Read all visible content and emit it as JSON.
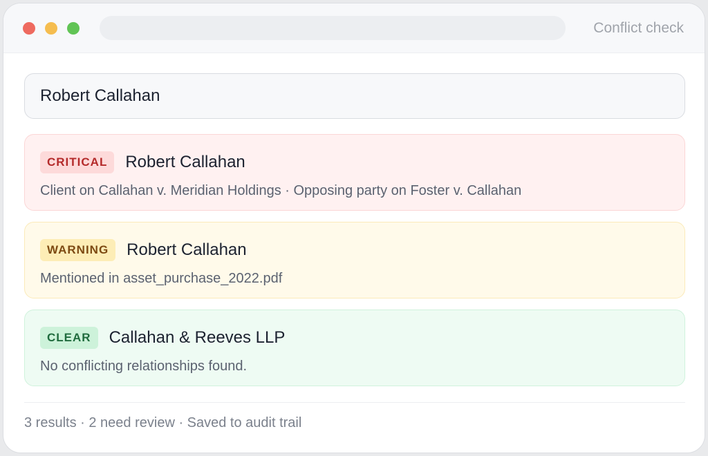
{
  "window": {
    "title": "Conflict check"
  },
  "search": {
    "value": "Robert Callahan"
  },
  "results": [
    {
      "level": "CRITICAL",
      "name": "Robert Callahan",
      "detail": "Client on Callahan v. Meridian Holdings · Opposing party on Foster v. Callahan",
      "color": "#b42a2a"
    },
    {
      "level": "WARNING",
      "name": "Robert Callahan",
      "detail": "Mentioned in asset_purchase_2022.pdf",
      "color": "#7d4a12"
    },
    {
      "level": "CLEAR",
      "name": "Callahan & Reeves LLP",
      "detail": "No conflicting relationships found.",
      "color": "#1f6b3d"
    }
  ],
  "footer": {
    "summary": "3 results · 2 need review · Saved to audit trail"
  }
}
